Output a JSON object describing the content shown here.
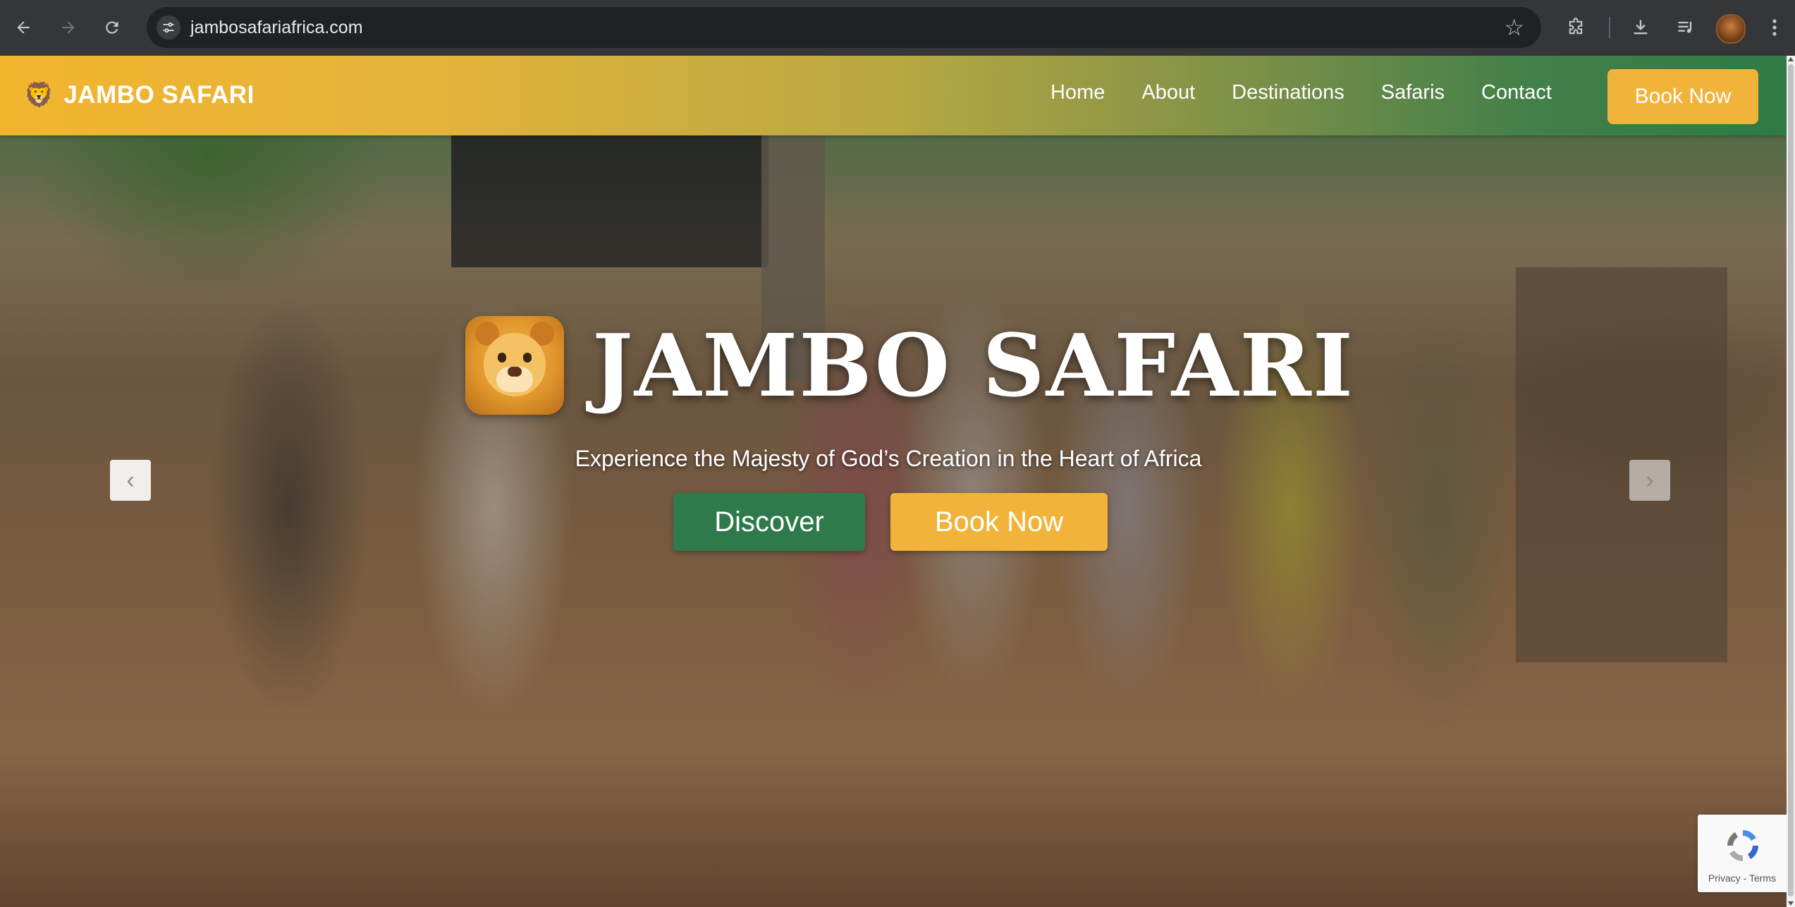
{
  "browser": {
    "url": "jambosafariafrica.com",
    "back_icon": "arrow-left",
    "forward_icon": "arrow-right",
    "reload_icon": "reload",
    "site_info_icon": "tune",
    "bookmark_icon": "star",
    "extensions_icon": "puzzle",
    "download_icon": "download",
    "media_icon": "media-queue",
    "menu_icon": "kebab"
  },
  "site": {
    "brand": "JAMBO SAFARI",
    "brand_icon": "🦁",
    "nav": [
      "Home",
      "About",
      "Destinations",
      "Safaris",
      "Contact"
    ],
    "book_now": "Book Now",
    "colors": {
      "gradient_start": "#f3b52e",
      "gradient_end": "#2e7a45",
      "accent_gold": "#f2b33a",
      "accent_green": "#2f7a4a"
    }
  },
  "hero": {
    "title": "JAMBO SAFARI",
    "subtitle": "Experience the Majesty of God’s Creation in the Heart of Africa",
    "discover_label": "Discover",
    "book_label": "Book Now",
    "prev_label": "‹",
    "next_label": "›"
  },
  "recaptcha": {
    "links": "Privacy - Terms"
  }
}
